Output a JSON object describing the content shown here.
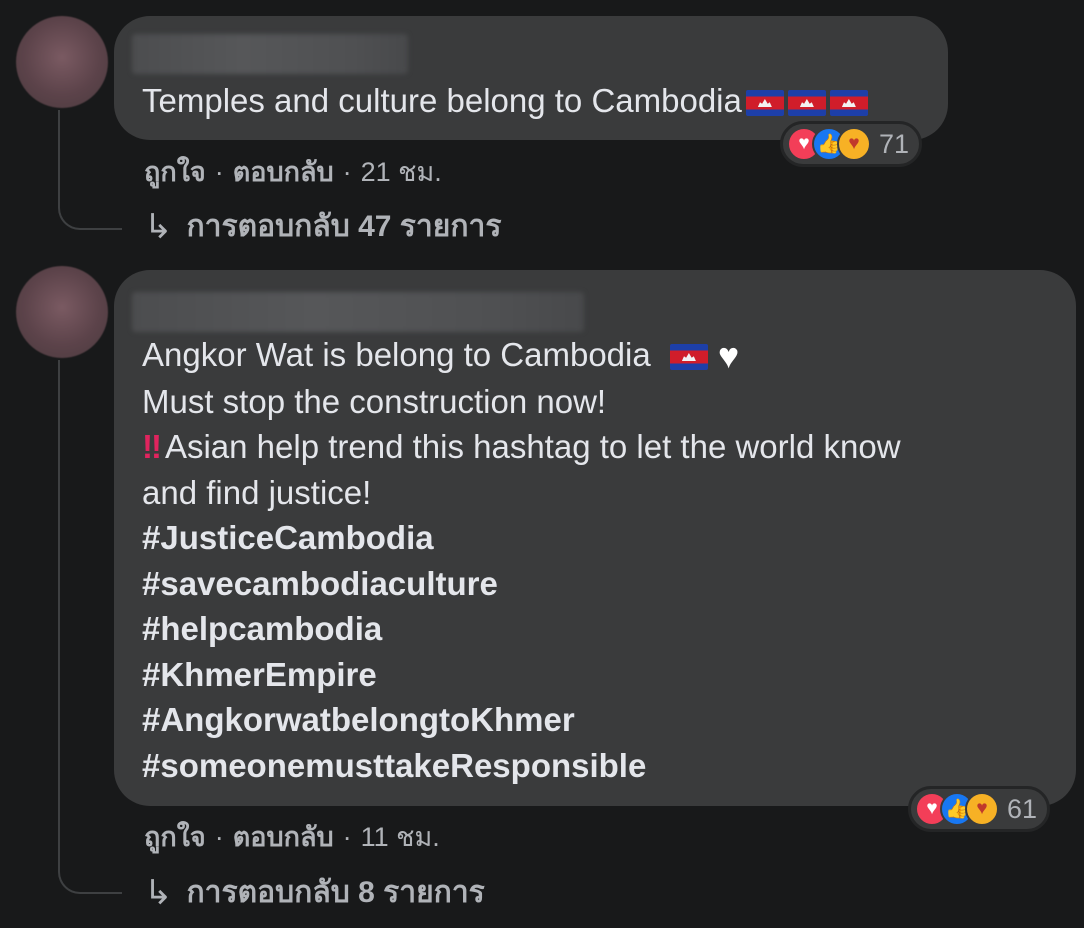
{
  "comments": [
    {
      "lines": [
        "Temples and culture belong to Cambodia"
      ],
      "flags": [
        "cambodia-flag",
        "cambodia-flag",
        "cambodia-flag"
      ],
      "reactions": {
        "icons": [
          "love",
          "like",
          "care"
        ],
        "count": "71"
      },
      "actions": {
        "like": "ถูกใจ",
        "reply": "ตอบกลับ",
        "time": "21 ชม.",
        "separator": "·"
      },
      "replies_label": "การตอบกลับ 47 รายการ"
    },
    {
      "lines": [
        "Angkor Wat is belong to Cambodia",
        "Must stop the construction now!",
        "Asian help trend this hashtag to let the world know",
        "and find justice!"
      ],
      "line1_emoji": [
        "cambodia-flag",
        "white-heart-icon"
      ],
      "line3_prefix": "‼",
      "hashtags": [
        "#JusticeCambodia",
        "#savecambodiaculture",
        "#helpcambodia",
        "#KhmerEmpire",
        "#AngkorwatbelongtoKhmer",
        "#someonemusttakeResponsible"
      ],
      "reactions": {
        "icons": [
          "love",
          "like",
          "care"
        ],
        "count": "61"
      },
      "actions": {
        "like": "ถูกใจ",
        "reply": "ตอบกลับ",
        "time": "11 ชม.",
        "separator": "·"
      },
      "replies_label": "การตอบกลับ 8 รายการ"
    }
  ],
  "colors": {
    "background": "#18191a",
    "bubble": "#3a3b3c",
    "text": "#e4e6eb",
    "secondary_text": "#b0b3b8",
    "love": "#f33e58",
    "like": "#1877f2",
    "care": "#f7b125"
  }
}
